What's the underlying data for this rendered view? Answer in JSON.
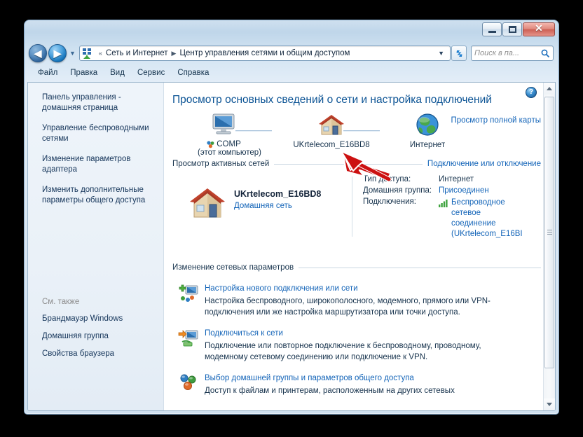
{
  "window": {
    "buttons": {
      "minimize": "minimize-button",
      "maximize": "maximize-button",
      "close": "close-button",
      "close_glyph": "✕"
    }
  },
  "nav": {
    "back_glyph": "◀",
    "forward_glyph": "▶",
    "dropdown_glyph": "▼",
    "refresh_glyph": "↯"
  },
  "address": {
    "icon": "network-icon",
    "overflow": "«",
    "separator": "▶",
    "crumbs": [
      "Сеть и Интернет",
      "Центр управления сетями и общим доступом"
    ],
    "dropdown_glyph": "▼"
  },
  "search": {
    "placeholder": "Поиск в па...",
    "icon": "search-icon"
  },
  "menu": {
    "items": [
      "Файл",
      "Правка",
      "Вид",
      "Сервис",
      "Справка"
    ]
  },
  "sidebar": {
    "links": [
      "Панель управления - домашняя страница",
      "Управление беспроводными сетями",
      "Изменение параметров адаптера",
      "Изменить дополнительные параметры общего доступа"
    ],
    "see_also_title": "См. также",
    "see_also": [
      "Брандмауэр Windows",
      "Домашняя группа",
      "Свойства браузера"
    ]
  },
  "content": {
    "help_glyph": "?",
    "page_title": "Просмотр основных сведений о сети и настройка подключений",
    "map": {
      "full_map_link": "Просмотр полной карты",
      "nodes": [
        {
          "icon": "computer-icon",
          "label": "COMP",
          "sublabel": "(этот компьютер)"
        },
        {
          "icon": "house-icon",
          "label": "UKrtelecom_E16BD8",
          "sublabel": ""
        },
        {
          "icon": "globe-icon",
          "label": "Интернет",
          "sublabel": ""
        }
      ]
    },
    "active_networks": {
      "heading": "Просмотр активных сетей",
      "action": "Подключение или отключение",
      "network_icon": "house-icon",
      "network_name": "UKrtelecom_E16BD8",
      "network_type": "Домашняя сеть",
      "details": [
        {
          "label": "Тип доступа:",
          "value": "Интернет",
          "is_link": false
        },
        {
          "label": "Домашняя группа:",
          "value": "Присоединен",
          "is_link": true
        },
        {
          "label": "Подключения:",
          "value": "Беспроводное сетевое соединение (UKrtelecom_E16BI",
          "is_link": true,
          "icon": "wifi-signal-icon"
        }
      ]
    },
    "network_settings": {
      "heading": "Изменение сетевых параметров",
      "items": [
        {
          "icon": "new-connection-icon",
          "title": "Настройка нового подключения или сети",
          "description": "Настройка беспроводного, широкополосного, модемного, прямого или VPN-подключения или же настройка маршрутизатора или точки доступа."
        },
        {
          "icon": "connect-network-icon",
          "title": "Подключиться к сети",
          "description": "Подключение или повторное подключение к беспроводному, проводному, модемному сетевому соединению или подключение к VPN."
        },
        {
          "icon": "homegroup-icon",
          "title": "Выбор домашней группы и параметров общего доступа",
          "description": "Доступ к файлам и принтерам, расположенным на других сетевых"
        }
      ]
    }
  },
  "scrollbar": {
    "up_arrow": "scroll-up-arrow",
    "down_arrow": "scroll-down-arrow",
    "thumb": "scroll-thumb"
  },
  "annotation": {
    "type": "red-arrow",
    "color": "#cc1111"
  },
  "colors": {
    "link": "#1364b8",
    "title": "#0b5394",
    "text": "#17334d",
    "accent_red": "#cc1111"
  }
}
